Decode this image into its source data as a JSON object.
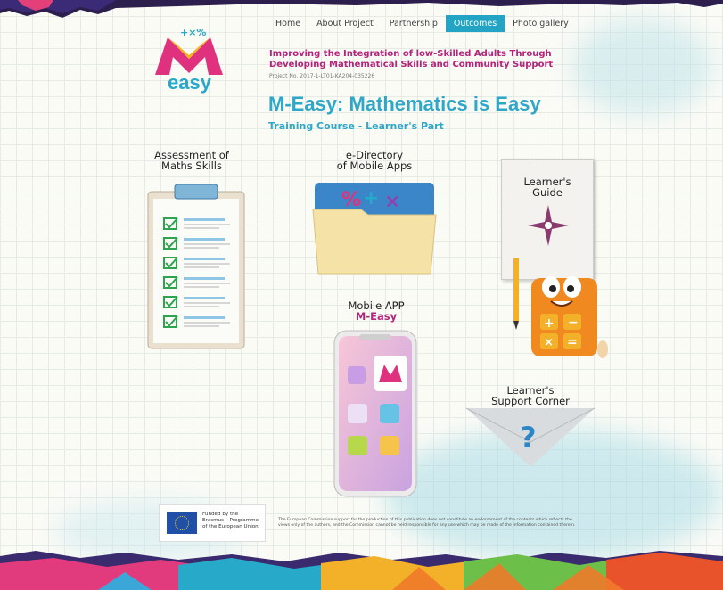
{
  "nav": {
    "items": [
      {
        "label": "Home",
        "active": false
      },
      {
        "label": "About Project",
        "active": false
      },
      {
        "label": "Partnership",
        "active": false
      },
      {
        "label": "Outcomes",
        "active": true
      },
      {
        "label": "Photo gallery",
        "active": false
      }
    ]
  },
  "logo": {
    "text": "easy",
    "letter": "M"
  },
  "header": {
    "project_title": "Improving the Integration of low-Skilled Adults Through Developing Mathematical Skills and Community Support",
    "project_no": "Project No. 2017-1-LT01-KA204-035226",
    "title": "M-Easy: Mathematics is Easy",
    "subtitle": "Training Course - Learner's Part"
  },
  "tiles": {
    "assessment": {
      "line1": "Assessment of",
      "line2": "Maths Skills"
    },
    "directory": {
      "line1": "e-Directory",
      "line2": "of Mobile Apps"
    },
    "guide": {
      "line1": "Learner's",
      "line2": "Guide"
    },
    "app": {
      "line1": "Mobile APP",
      "line2": "M-Easy"
    },
    "support": {
      "line1": "Learner's",
      "line2": "Support Corner"
    }
  },
  "footer": {
    "eu_line1": "Funded by the",
    "eu_line2": "Erasmus+ Programme",
    "eu_line3": "of the European Union",
    "disclaimer": "The European Commission support for the production of this publication does not constitute an endorsement of the contents which reflects the views only of the authors, and the Commission cannot be held responsible for any use which may be made of the information contained therein."
  },
  "colors": {
    "accent": "#23a4c4",
    "brand": "#b3247a",
    "check": "#2ea44f"
  }
}
